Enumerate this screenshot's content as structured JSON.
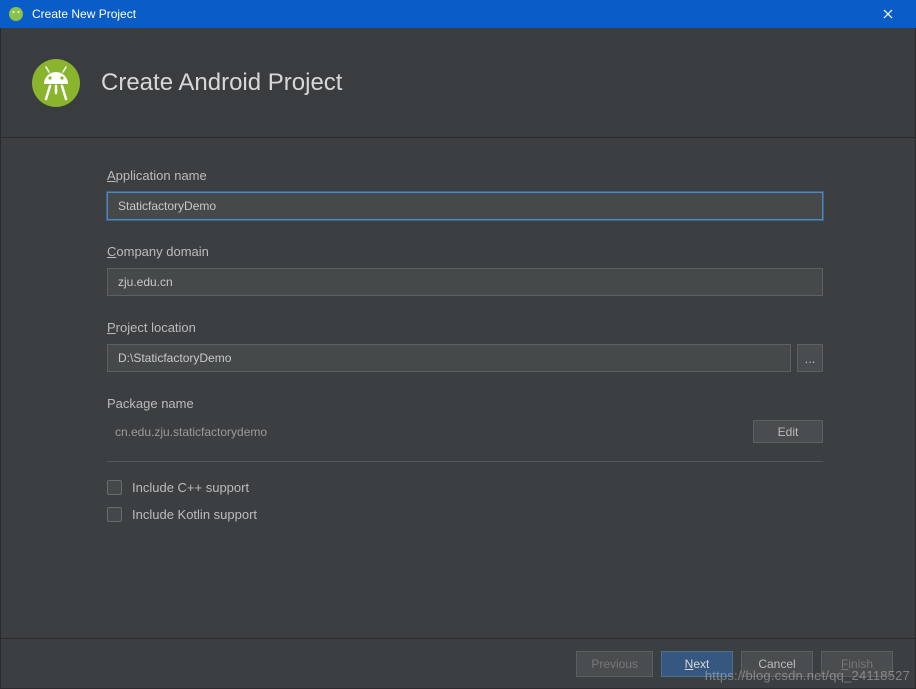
{
  "titleBar": {
    "title": "Create New Project"
  },
  "header": {
    "title": "Create Android Project"
  },
  "form": {
    "appName": {
      "label": "Application name",
      "value": "StaticfactoryDemo"
    },
    "companyDomain": {
      "label": "Company domain",
      "value": "zju.edu.cn"
    },
    "projectLocation": {
      "label": "Project location",
      "value": "D:\\StaticfactoryDemo",
      "browseLabel": "..."
    },
    "packageName": {
      "label": "Package name",
      "value": "cn.edu.zju.staticfactorydemo",
      "editLabel": "Edit"
    },
    "includeCpp": {
      "label": "Include C++ support",
      "checked": false
    },
    "includeKotlin": {
      "label": "Include Kotlin support",
      "checked": false
    }
  },
  "footer": {
    "previous": "Previous",
    "next": "Next",
    "cancel": "Cancel",
    "finish": "Finish"
  },
  "watermark": "https://blog.csdn.net/qq_24118527"
}
